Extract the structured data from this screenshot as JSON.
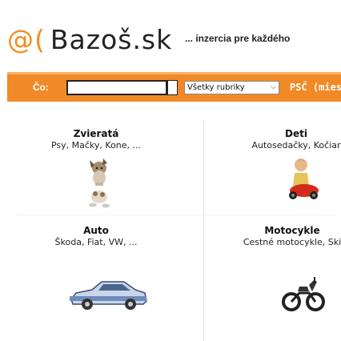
{
  "header": {
    "logo_at": "@(",
    "logo_name": "Bazoš.sk",
    "tagline": "... inzercia pre každého"
  },
  "search": {
    "query_label": "Čo:",
    "query_value": "",
    "category_selected": "Všetky rubriky",
    "psc_label": "PSČ (mies"
  },
  "categories": [
    {
      "title": "Zvieratá",
      "subtitle": "Psy, Mačky, Kone, ...",
      "icon": "animals-icon"
    },
    {
      "title": "Deti",
      "subtitle": "Autosedačky, Kočiar",
      "icon": "kids-icon"
    },
    {
      "title": "Auto",
      "subtitle": "Škoda, Fiat, VW, ...",
      "icon": "car-icon"
    },
    {
      "title": "Motocykle",
      "subtitle": "Cestné motocykle, Ski",
      "icon": "motorcycle-icon"
    }
  ],
  "colors": {
    "brand_orange": "#f18a26",
    "logo_orange": "#f48c1c"
  }
}
